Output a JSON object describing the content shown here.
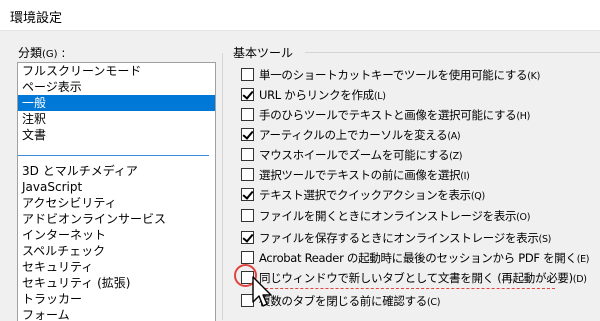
{
  "window": {
    "title": "環境設定"
  },
  "categories": {
    "label": "分類",
    "accel": "(G)",
    "colon": " :",
    "group1": [
      {
        "text": "フルスクリーンモード",
        "selected": false
      },
      {
        "text": "ページ表示",
        "selected": false
      },
      {
        "text": "一般",
        "selected": true
      },
      {
        "text": "注釈",
        "selected": false
      },
      {
        "text": "文書",
        "selected": false
      }
    ],
    "group2": [
      "3D とマルチメディア",
      "JavaScript",
      "アクセシビリティ",
      "アドビオンラインサービス",
      "インターネット",
      "スペルチェック",
      "セキュリティ",
      "セキュリティ (拡張)",
      "トラッカー",
      "フォーム"
    ]
  },
  "basic_tools": {
    "title": "基本ツール",
    "options": [
      {
        "label": "単一のショートカットキーでツールを使用可能にする",
        "accel": "(K)",
        "checked": false
      },
      {
        "label": "URL からリンクを作成",
        "accel": "(L)",
        "checked": true
      },
      {
        "label": "手のひらツールでテキストと画像を選択可能にする",
        "accel": "(H)",
        "checked": false
      },
      {
        "label": "アーティクルの上でカーソルを変える",
        "accel": "(A)",
        "checked": true
      },
      {
        "label": "マウスホイールでズームを可能にする",
        "accel": "(Z)",
        "checked": false
      },
      {
        "label": "選択ツールでテキストの前に画像を選択",
        "accel": "(I)",
        "checked": false
      },
      {
        "label": "テキスト選択でクイックアクションを表示",
        "accel": "(Q)",
        "checked": true
      },
      {
        "label": "ファイルを開くときにオンラインストレージを表示",
        "accel": "(O)",
        "checked": false
      },
      {
        "label": "ファイルを保存するときにオンラインストレージを表示",
        "accel": "(S)",
        "checked": true
      },
      {
        "label": "Acrobat Reader の起動時に最後のセッションから PDF を開く",
        "accel": "(E)",
        "checked": false
      },
      {
        "label": "同じウィンドウで新しいタブとして文書を開く (再起動が必要)",
        "accel": "(D)",
        "checked": false
      },
      {
        "label": "複数のタブを閉じる前に確認する",
        "accel": "(C)",
        "checked": false
      }
    ]
  },
  "colors": {
    "selection": "#0078d7",
    "highlight": "#e0443e"
  }
}
